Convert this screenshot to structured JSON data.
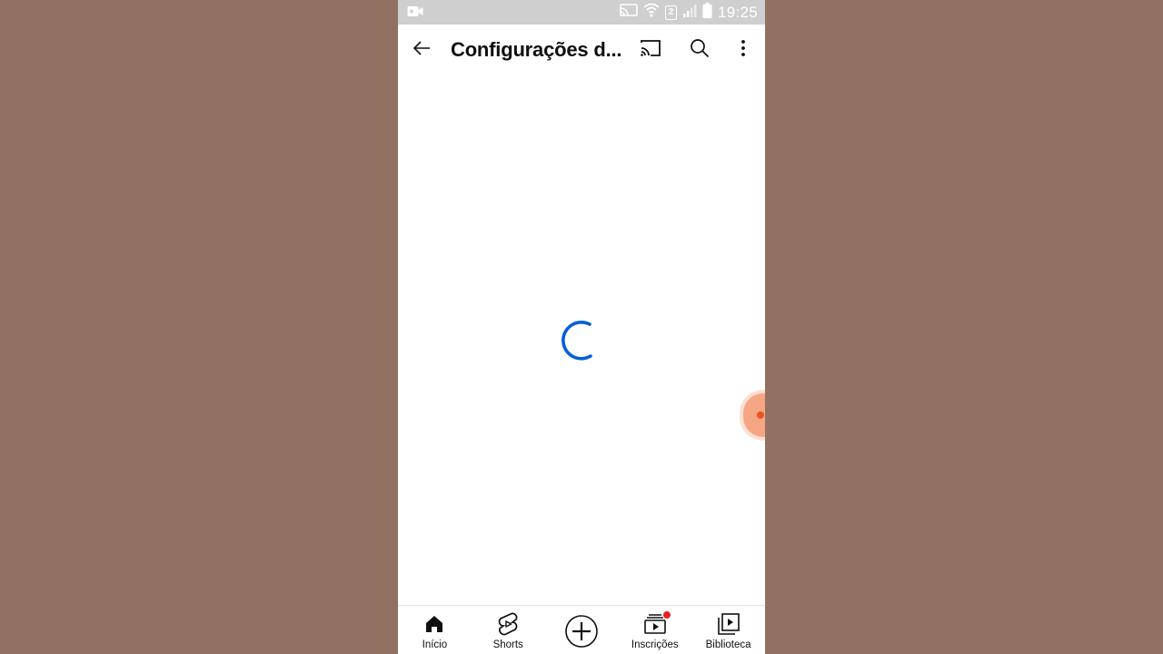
{
  "status_bar": {
    "time": "19:25",
    "sim_slot": "2"
  },
  "app_bar": {
    "title": "Configurações d..."
  },
  "icons": {
    "back": "arrow-left-icon",
    "cast": "cast-icon",
    "search": "search-icon",
    "more": "more-vertical-icon",
    "loading": "loading-spinner"
  },
  "bottom_nav": {
    "items": [
      {
        "label": "Início",
        "icon": "home-icon"
      },
      {
        "label": "Shorts",
        "icon": "shorts-icon"
      },
      {
        "label": "",
        "icon": "create-plus-icon"
      },
      {
        "label": "Inscrições",
        "icon": "subscriptions-icon"
      },
      {
        "label": "Biblioteca",
        "icon": "library-icon"
      }
    ]
  },
  "colors": {
    "background": "#917161",
    "spinner": "#065fd4",
    "notification": "#e52222",
    "floating_bubble": "#f6a585"
  }
}
